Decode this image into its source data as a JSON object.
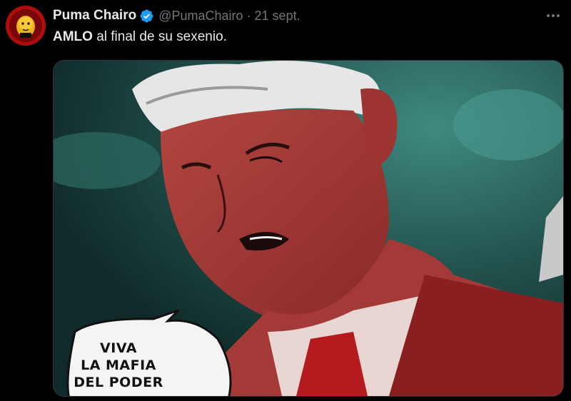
{
  "tweet": {
    "author_name": "Puma Chairo",
    "handle": "@PumaChairo",
    "separator": "·",
    "date": "21 sept.",
    "text_bold": "AMLO",
    "text_rest": " al final de su sexenio."
  },
  "media": {
    "speech_bubble": {
      "line1": "VIVA",
      "line2": "LA MAFIA",
      "line3": "DEL PODER"
    }
  },
  "icons": {
    "avatar": "puma-avatar",
    "verified": "verified-badge-icon",
    "more": "more-options-icon"
  },
  "colors": {
    "background": "#000000",
    "text_primary": "#e7e9ea",
    "text_secondary": "#71767b",
    "verified_blue": "#1d9bf0",
    "avatar_red": "#b00d0d"
  }
}
